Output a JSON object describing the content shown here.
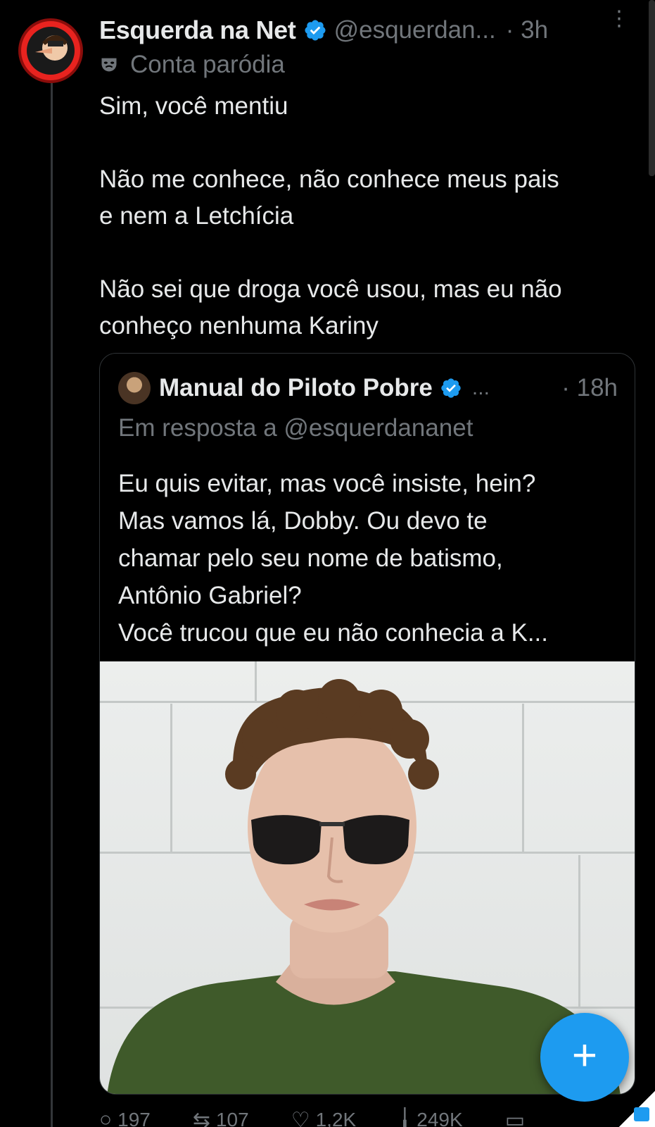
{
  "post": {
    "author_name": "Esquerda na Net",
    "handle": "@esquerdan...",
    "time": "· 3h",
    "more": "⋮",
    "parody_label": "Conta paródia",
    "text": "Sim, você mentiu\n\nNão me conhece, não conhece meus pais\ne nem a Letchícia\n\nNão sei que droga você usou, mas eu não\nconheço nenhuma Kariny"
  },
  "quote": {
    "author_name": "Manual do Piloto Pobre",
    "dots": "...",
    "time": "· 18h",
    "reply_to": "Em resposta a @esquerdananet",
    "text": "Eu quis evitar, mas você insiste, hein?\nMas vamos lá, Dobby. Ou devo te\nchamar pelo seu nome de batismo,\nAntônio Gabriel?\nVocê trucou que eu não conhecia a K..."
  },
  "actions": {
    "replies": "197",
    "reposts": "107",
    "likes": "1,2K",
    "views": "249K"
  },
  "fab": {
    "label": "+"
  },
  "colors": {
    "background": "#000000",
    "text_primary": "#e7e9ea",
    "text_secondary": "#71767b",
    "accent": "#1d9bf0",
    "border": "#2f3336"
  },
  "icons": [
    "parody-mask-icon",
    "verified-badge-icon",
    "more-icon",
    "reply-icon",
    "repost-icon",
    "like-icon",
    "views-icon",
    "bookmark-icon",
    "share-icon",
    "plus-icon"
  ]
}
